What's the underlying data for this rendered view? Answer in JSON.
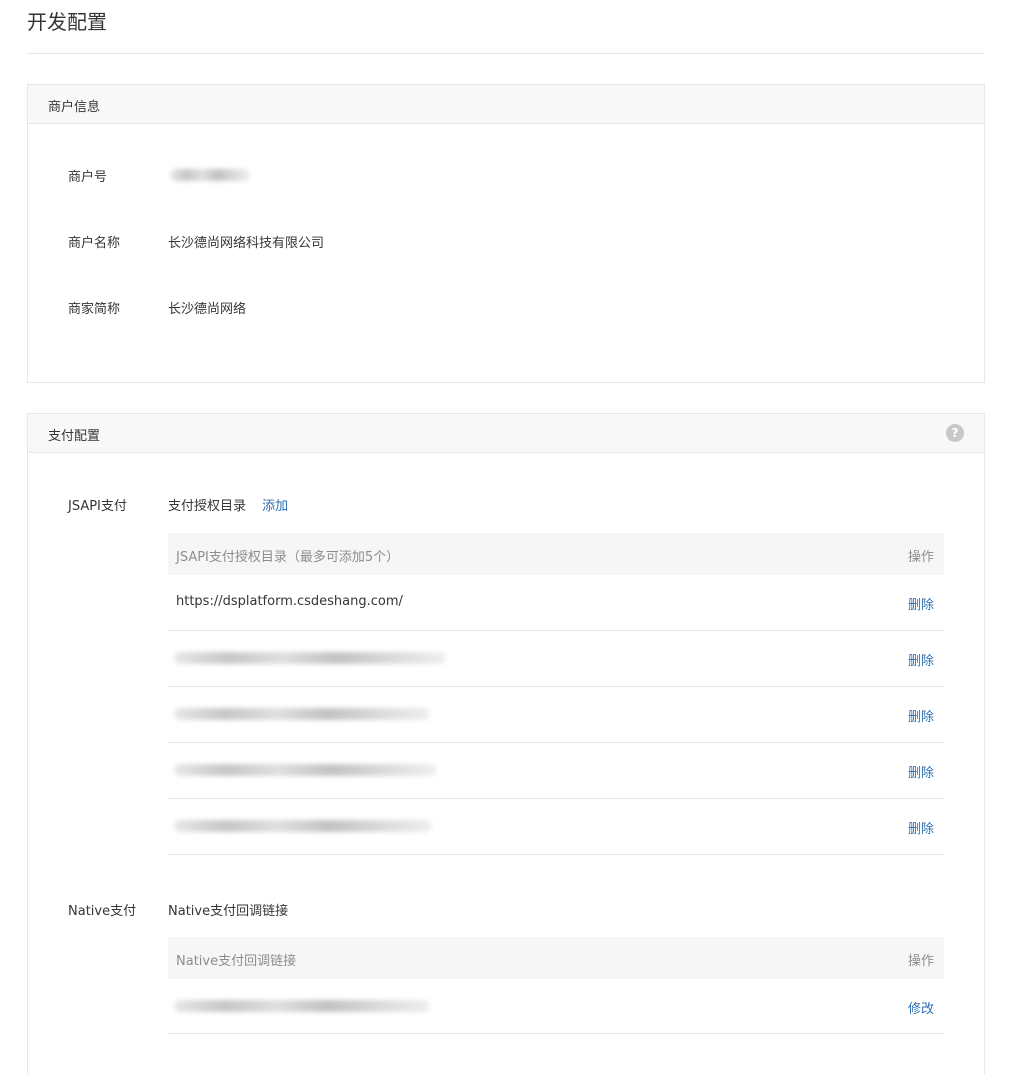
{
  "page": {
    "title": "开发配置"
  },
  "merchant_info": {
    "header": "商户信息",
    "fields": [
      {
        "label": "商户号",
        "value": ""
      },
      {
        "label": "商户名称",
        "value": "长沙德尚网络科技有限公司"
      },
      {
        "label": "商家简称",
        "value": "长沙德尚网络"
      }
    ]
  },
  "payment_config": {
    "header": "支付配置",
    "help_icon": "?",
    "jsapi": {
      "label": "JSAPI支付",
      "sub_label": "支付授权目录",
      "add_link": "添加",
      "table": {
        "header_left": "JSAPI支付授权目录（最多可添加5个）",
        "header_right": "操作",
        "rows": [
          {
            "url": "https://dsplatform.csdeshang.com/",
            "action": "删除"
          },
          {
            "url": "",
            "action": "删除"
          },
          {
            "url": "",
            "action": "删除"
          },
          {
            "url": "",
            "action": "删除"
          },
          {
            "url": "",
            "action": "删除"
          }
        ]
      }
    },
    "native": {
      "label": "Native支付",
      "sub_label": "Native支付回调链接",
      "table": {
        "header_left": "Native支付回调链接",
        "header_right": "操作",
        "rows": [
          {
            "url": "",
            "action": "修改"
          }
        ]
      }
    }
  },
  "colors": {
    "link": "#2f6fb5",
    "header_bg": "#f8f8f8",
    "border": "#e7e7eb"
  }
}
